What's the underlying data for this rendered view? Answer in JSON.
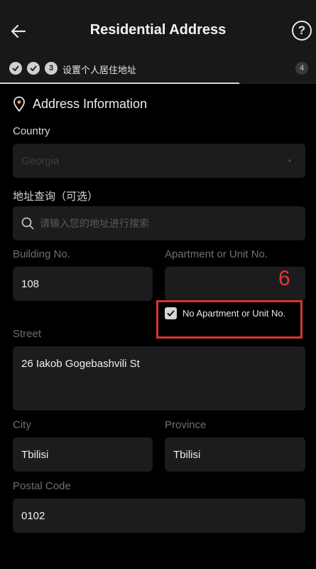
{
  "header": {
    "title": "Residential Address",
    "help_label": "?"
  },
  "progress": {
    "current_step": "3",
    "step_label": "设置个人居住地址",
    "total_steps": "4",
    "fraction_complete": 0.76
  },
  "section": {
    "title": "Address Information"
  },
  "country": {
    "label": "Country",
    "value": "Georgia"
  },
  "address_search": {
    "label": "地址查询（可选）",
    "placeholder": "请输入您的地址进行搜索"
  },
  "building": {
    "label": "Building No.",
    "value": "108"
  },
  "apartment": {
    "label": "Apartment or Unit No.",
    "value": "",
    "no_apartment_label": "No Apartment or Unit No.",
    "no_apartment_checked": true
  },
  "annotation": {
    "number": "6",
    "color": "#d8342c"
  },
  "street": {
    "label": "Street",
    "value": "26 Iakob Gogebashvili St"
  },
  "city": {
    "label": "City",
    "value": "Tbilisi"
  },
  "province": {
    "label": "Province",
    "value": "Tbilisi"
  },
  "postal": {
    "label": "Postal Code",
    "value": "0102"
  },
  "icons": {
    "back": "arrow-left-icon",
    "help": "question-circle-icon",
    "completed_step": "check-icon",
    "location": "map-pin-icon",
    "search": "search-icon",
    "checkbox": "check-icon"
  }
}
